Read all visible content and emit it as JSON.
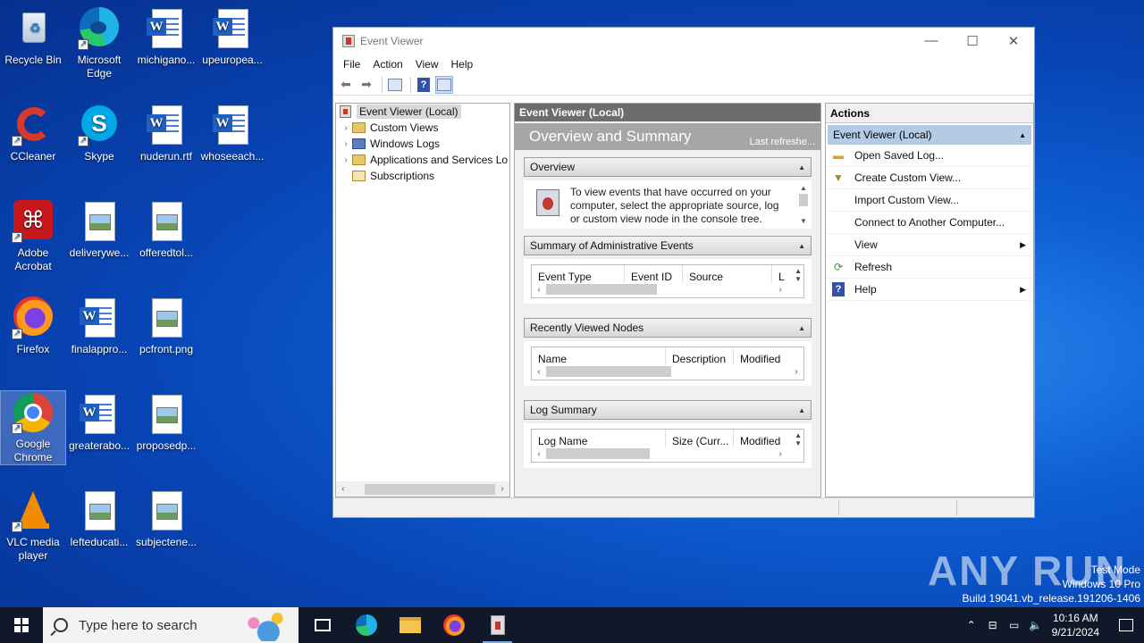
{
  "desktop": {
    "icons": [
      {
        "label": "Recycle Bin"
      },
      {
        "label": "Microsoft Edge"
      },
      {
        "label": "michigano..."
      },
      {
        "label": "upeuropea..."
      },
      {
        "label": "CCleaner"
      },
      {
        "label": "Skype"
      },
      {
        "label": "nuderun.rtf"
      },
      {
        "label": "whoseeach..."
      },
      {
        "label": "Adobe Acrobat"
      },
      {
        "label": "deliverywe..."
      },
      {
        "label": "offeredtol..."
      },
      {
        "label": "Firefox"
      },
      {
        "label": "finalappro..."
      },
      {
        "label": "pcfront.png"
      },
      {
        "label": "Google Chrome"
      },
      {
        "label": "greaterabo..."
      },
      {
        "label": "proposedp..."
      },
      {
        "label": "VLC media player"
      },
      {
        "label": "lefteducati..."
      },
      {
        "label": "subjectene..."
      }
    ]
  },
  "window": {
    "title": "Event Viewer",
    "menu": [
      "File",
      "Action",
      "View",
      "Help"
    ],
    "tree": {
      "root": "Event Viewer (Local)",
      "items": [
        "Custom Views",
        "Windows Logs",
        "Applications and Services Lo",
        "Subscriptions"
      ]
    },
    "center": {
      "header": "Event Viewer (Local)",
      "banner_title": "Overview and Summary",
      "banner_refresh": "Last refreshe...",
      "overview": {
        "title": "Overview",
        "text": "To view events that have occurred on your computer, select the appropriate source, log or custom view node in the console tree."
      },
      "summary": {
        "title": "Summary of Administrative Events",
        "columns": [
          "Event Type",
          "Event ID",
          "Source",
          "L"
        ]
      },
      "recent": {
        "title": "Recently Viewed Nodes",
        "columns": [
          "Name",
          "Description",
          "Modified"
        ]
      },
      "logsummary": {
        "title": "Log Summary",
        "columns": [
          "Log Name",
          "Size (Curr...",
          "Modified"
        ]
      }
    },
    "actions": {
      "header": "Actions",
      "group": "Event Viewer (Local)",
      "items": [
        {
          "label": "Open Saved Log..."
        },
        {
          "label": "Create Custom View..."
        },
        {
          "label": "Import Custom View..."
        },
        {
          "label": "Connect to Another Computer..."
        },
        {
          "label": "View"
        },
        {
          "label": "Refresh"
        },
        {
          "label": "Help"
        }
      ]
    }
  },
  "watermark": {
    "brand": "ANY RUN",
    "mode": "Test Mode",
    "edition": "Windows 10 Pro",
    "build": "Build 19041.vb_release.191206-1406"
  },
  "taskbar": {
    "search_placeholder": "Type here to search",
    "time": "10:16 AM",
    "date": "9/21/2024"
  }
}
